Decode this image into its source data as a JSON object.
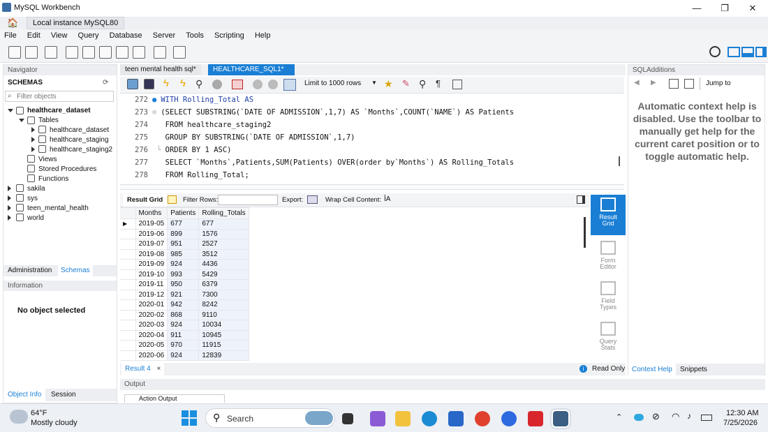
{
  "window": {
    "title": "MySQL Workbench",
    "minimize": "—",
    "maximize": "❐",
    "close": "✕"
  },
  "connection_tab": {
    "label": "Local instance MySQL80",
    "close": "×"
  },
  "menu": [
    "File",
    "Edit",
    "View",
    "Query",
    "Database",
    "Server",
    "Tools",
    "Scripting",
    "Help"
  ],
  "navigator": {
    "header": "Navigator",
    "schemas_label": "SCHEMAS",
    "filter_placeholder": "Filter objects",
    "tree": {
      "db": "healthcare_dataset",
      "tables": "Tables",
      "table_items": [
        "healthcare_dataset",
        "healthcare_staging",
        "healthcare_staging2"
      ],
      "views": "Views",
      "procedures": "Stored Procedures",
      "functions": "Functions",
      "other_schemas": [
        "sakila",
        "sys",
        "teen_mental_health",
        "world"
      ]
    },
    "tabs": [
      "Administration",
      "Schemas"
    ],
    "info_header": "Information",
    "no_object": "No object selected",
    "bottom_tabs": [
      "Object Info",
      "Session"
    ]
  },
  "editor_tabs": [
    "teen mental health sql*",
    "HEALTHCARE_SQL1*"
  ],
  "editor_toolbar": {
    "limit": "Limit to 1000 rows"
  },
  "code_lines": [
    {
      "n": "272",
      "text": "WITH Rolling_Total AS"
    },
    {
      "n": "273",
      "text": "(SELECT SUBSTRING(`DATE OF ADMISSION`,1,7) AS `Months`,COUNT(`NAME`) AS Patients"
    },
    {
      "n": "274",
      "text": "FROM healthcare_staging2"
    },
    {
      "n": "275",
      "text": "GROUP BY SUBSTRING(`DATE OF ADMISSION`,1,7)"
    },
    {
      "n": "276",
      "text": "ORDER BY 1 ASC)"
    },
    {
      "n": "277",
      "text": "SELECT `Months`,Patients,SUM(Patients) OVER(order by`Months`) AS Rolling_Totals"
    },
    {
      "n": "278",
      "text": "FROM Rolling_Total;"
    }
  ],
  "result_bar": {
    "result_grid": "Result Grid",
    "filter_rows": "Filter Rows:",
    "export": "Export:",
    "wrap": "Wrap Cell Content:"
  },
  "result": {
    "columns": [
      "Months",
      "Patients",
      "Rolling_Totals"
    ],
    "rows": [
      [
        "2019-05",
        "677",
        "677"
      ],
      [
        "2019-06",
        "899",
        "1576"
      ],
      [
        "2019-07",
        "951",
        "2527"
      ],
      [
        "2019-08",
        "985",
        "3512"
      ],
      [
        "2019-09",
        "924",
        "4436"
      ],
      [
        "2019-10",
        "993",
        "5429"
      ],
      [
        "2019-11",
        "950",
        "6379"
      ],
      [
        "2019-12",
        "921",
        "7300"
      ],
      [
        "2020-01",
        "942",
        "8242"
      ],
      [
        "2020-02",
        "868",
        "9110"
      ],
      [
        "2020-03",
        "924",
        "10034"
      ],
      [
        "2020-04",
        "911",
        "10945"
      ],
      [
        "2020-05",
        "970",
        "11915"
      ],
      [
        "2020-06",
        "924",
        "12839"
      ]
    ]
  },
  "side_buttons": [
    {
      "label": "Result\nGrid"
    },
    {
      "label": "Form\nEditor"
    },
    {
      "label": "Field\nTypes"
    },
    {
      "label": "Query\nStats"
    }
  ],
  "result_tab": {
    "label": "Result 4",
    "close": "×",
    "read_only": "Read Only"
  },
  "output": {
    "header": "Output",
    "action_output": "Action Output"
  },
  "sql_additions": {
    "header": "SQLAdditions",
    "jump_to": "Jump to",
    "help_text": "Automatic context help is disabled. Use the toolbar to manually get help for the current caret position or to toggle automatic help.",
    "tabs": [
      "Context Help",
      "Snippets"
    ]
  },
  "taskbar": {
    "weather_temp": "64°F",
    "weather_desc": "Mostly cloudy",
    "search": "Search",
    "time": "12:30 AM",
    "date": "7/25/2026"
  },
  "colors": {
    "accent": "#1a7fd4",
    "selected_tab": "#1a7fd4",
    "keyword": "#1f3fa8"
  }
}
